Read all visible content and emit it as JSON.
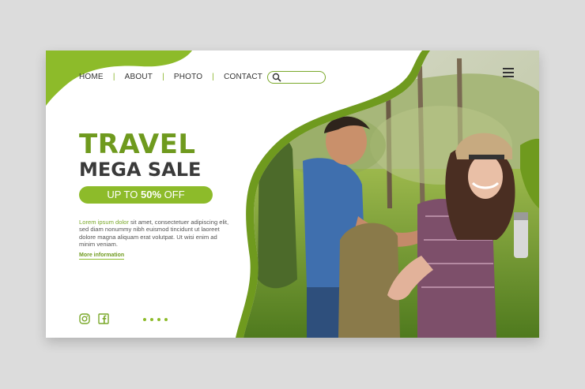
{
  "nav": {
    "items": [
      "HOME",
      "ABOUT",
      "PHOTO",
      "CONTACT"
    ],
    "separator": "|"
  },
  "search": {
    "icon": "search-icon",
    "placeholder": ""
  },
  "menu_icon": "hamburger-menu-icon",
  "hero": {
    "title_line1": "TRAVEL",
    "title_line2": "MEGA SALE",
    "promo_prefix": "UP TO ",
    "promo_value": "50%",
    "promo_suffix": " OFF",
    "description_highlight": "Lorem ipsum dolor",
    "description_rest": " sit amet, consectetuer adipiscing elit, sed diam nonummy nibh euismod tincidunt ut laoreet dolore magna aliquam erat volutpat. Ut wisi enim ad minim veniam.",
    "more_link": "More information"
  },
  "social": [
    "instagram-icon",
    "facebook-icon"
  ],
  "pagination_dots": 4,
  "colors": {
    "accent": "#8dbb2a",
    "title_green": "#6f9a1e",
    "dark_text": "#3a3a3a",
    "background": "#dcdcdc"
  }
}
